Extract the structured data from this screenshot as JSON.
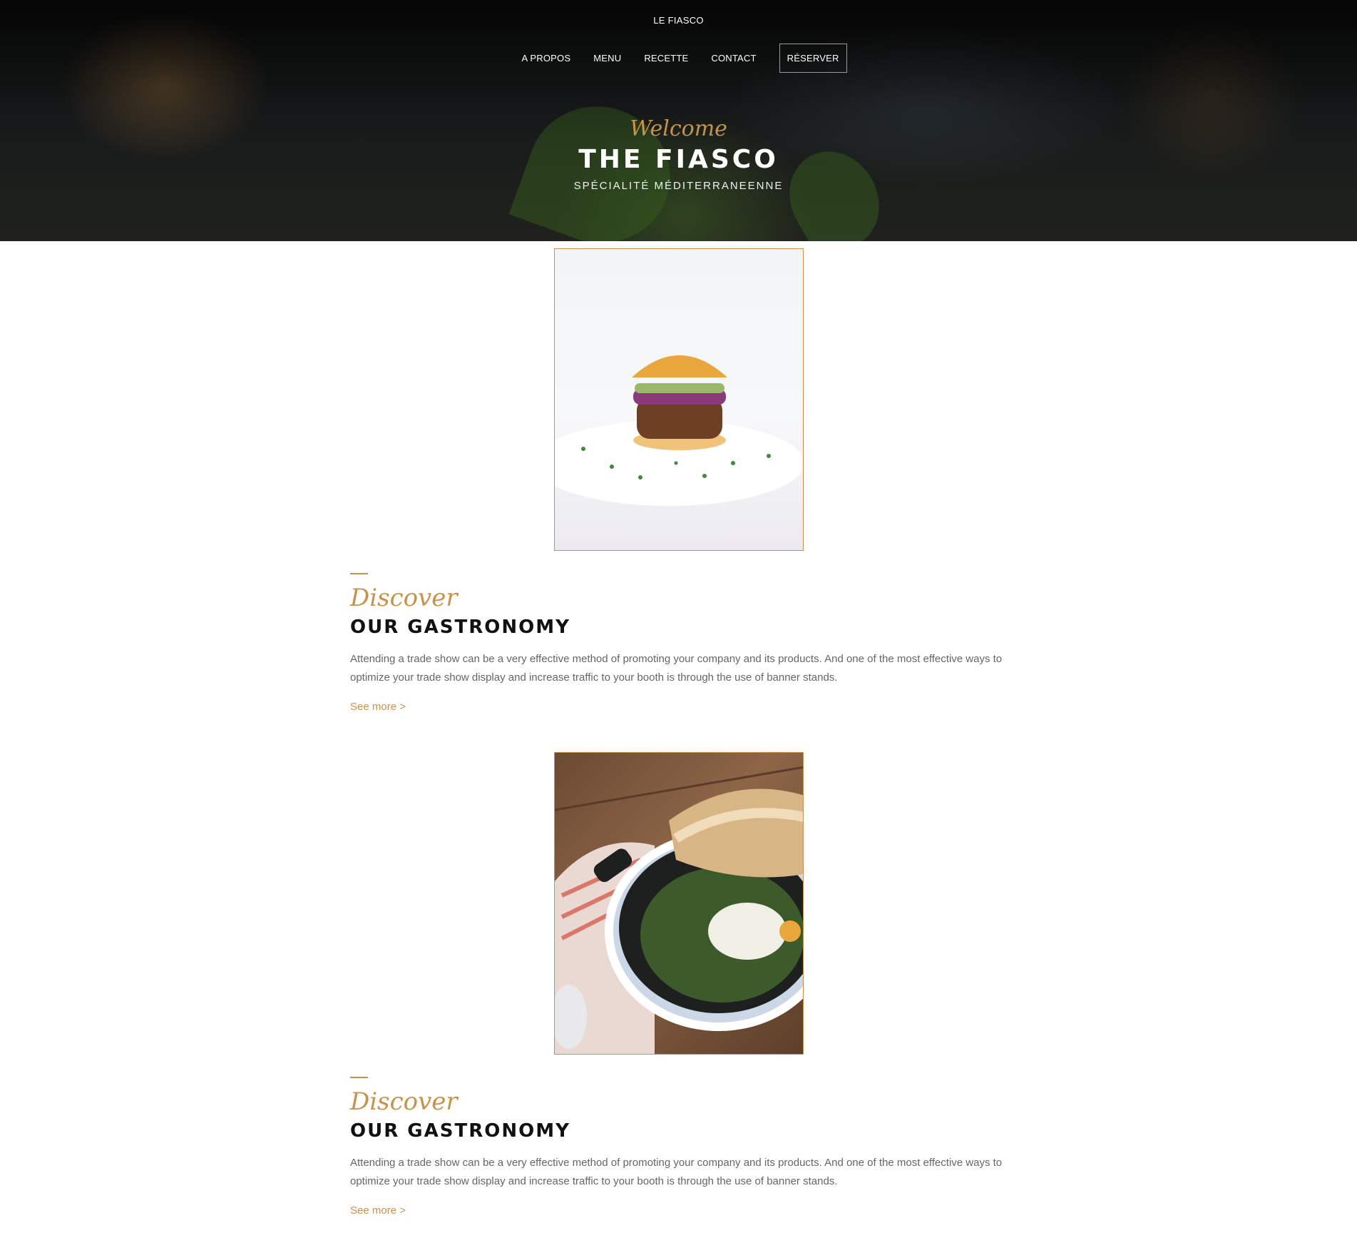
{
  "header": {
    "brand": "LE FIASCO",
    "nav": [
      {
        "label": "A PROPOS"
      },
      {
        "label": "MENU"
      },
      {
        "label": "RECETTE"
      },
      {
        "label": "CONTACT"
      }
    ],
    "reserve_label": "RÉSERVER"
  },
  "hero": {
    "welcome": "Welcome",
    "title": "THE FIASCO",
    "subtitle": "SPÉCIALITÉ MÉDITERRANEENNE"
  },
  "sections": [
    {
      "image": "burger-photo",
      "kicker": "Discover",
      "title": "OUR GASTRONOMY",
      "text": "Attending a trade show can be a very effective method of promoting your company and its products. And one of the most effective ways to optimize your trade show display and increase traffic to your booth is through the use of banner stands.",
      "link": "See more >"
    },
    {
      "image": "skillet-photo",
      "kicker": "Discover",
      "title": "OUR GASTRONOMY",
      "text": "Attending a trade show can be a very effective method of promoting your company and its products. And one of the most effective ways to optimize your trade show display and increase traffic to your booth is through the use of banner stands.",
      "link": "See more >"
    }
  ],
  "colors": {
    "accent": "#c8924a",
    "heading": "#111111",
    "body_text": "#666666"
  }
}
